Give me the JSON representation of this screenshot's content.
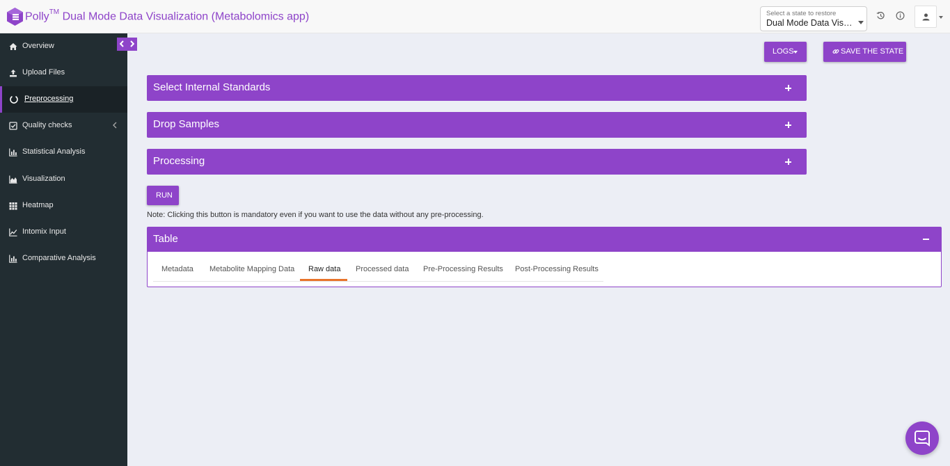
{
  "header": {
    "title": "Polly",
    "trademark": "TM",
    "subtitle": "Dual Mode Data Visualization (Metabolomics app)",
    "state_select": {
      "label": "Select a state to restore",
      "value": "Dual Mode Data Visu..."
    }
  },
  "sidebar": {
    "items": [
      {
        "label": "Overview",
        "icon": "home-icon"
      },
      {
        "label": "Upload Files",
        "icon": "upload-icon"
      },
      {
        "label": "Preprocessing",
        "icon": "circle-notch-icon"
      },
      {
        "label": "Quality checks",
        "icon": "check-square-icon"
      },
      {
        "label": "Statistical Analysis",
        "icon": "bar-chart-icon"
      },
      {
        "label": "Visualization",
        "icon": "area-chart-icon"
      },
      {
        "label": "Heatmap",
        "icon": "grid-icon"
      },
      {
        "label": "Intomix Input",
        "icon": "line-chart-icon"
      },
      {
        "label": "Comparative Analysis",
        "icon": "bar-chart-icon"
      }
    ],
    "active_index": 2
  },
  "toolbar": {
    "logs_label": "LOGS",
    "save_label": "SAVE THE STATE"
  },
  "panels": [
    {
      "title": "Select Internal Standards"
    },
    {
      "title": "Drop Samples"
    },
    {
      "title": "Processing"
    }
  ],
  "run": {
    "label": "RUN",
    "note": "Note: Clicking this button is mandatory even if you want to use the data without any pre-processing."
  },
  "table_panel": {
    "title": "Table",
    "tabs": [
      "Metadata",
      "Metabolite Mapping Data",
      "Raw data",
      "Processed data",
      "Pre-Processing Results",
      "Post-Processing Results"
    ],
    "active_tab": "Raw data"
  },
  "colors": {
    "accent": "#8e44c9",
    "sidebar_bg": "#222d32",
    "page_bg": "#eceef5",
    "tab_underline": "#e8742a"
  }
}
